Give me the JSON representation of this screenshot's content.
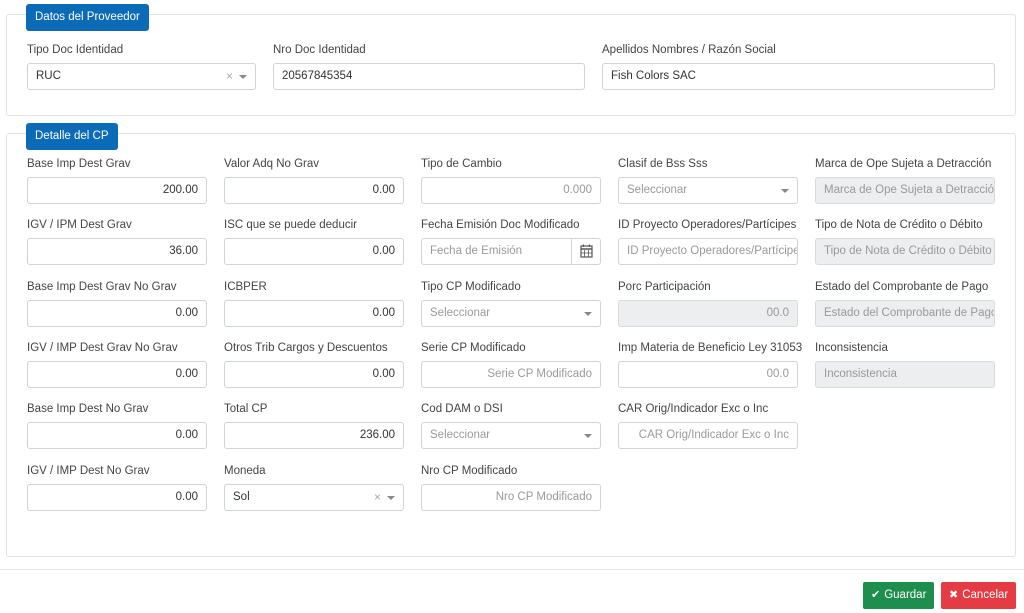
{
  "proveedor": {
    "title": "Datos del Proveedor",
    "tipo_doc": {
      "label": "Tipo Doc Identidad",
      "value": "RUC"
    },
    "nro_doc": {
      "label": "Nro Doc Identidad",
      "value": "20567845354"
    },
    "razon_social": {
      "label": "Apellidos Nombres / Razón Social",
      "value": "Fish Colors SAC"
    }
  },
  "detalle": {
    "title": "Detalle del CP",
    "col1": [
      {
        "label": "Base Imp Dest Grav",
        "value": "200.00"
      },
      {
        "label": "IGV / IPM Dest Grav",
        "value": "36.00"
      },
      {
        "label": "Base Imp Dest Grav No Grav",
        "value": "0.00"
      },
      {
        "label": "IGV / IMP Dest Grav No Grav",
        "value": "0.00"
      },
      {
        "label": "Base Imp Dest No Grav",
        "value": "0.00"
      },
      {
        "label": "IGV / IMP Dest No Grav",
        "value": "0.00"
      }
    ],
    "col2": [
      {
        "label": "Valor Adq No Grav",
        "value": "0.00"
      },
      {
        "label": "ISC que se puede deducir",
        "value": "0.00"
      },
      {
        "label": "ICBPER",
        "value": "0.00"
      },
      {
        "label": "Otros Trib Cargos y Descuentos",
        "value": "0.00"
      },
      {
        "label": "Total CP",
        "value": "236.00"
      },
      {
        "label": "Moneda",
        "value": "Sol"
      }
    ],
    "col3": [
      {
        "label": "Tipo de Cambio",
        "placeholder": "0.000"
      },
      {
        "label": "Fecha Emisión Doc Modificado",
        "placeholder": "Fecha de Emisión"
      },
      {
        "label": "Tipo CP Modificado",
        "placeholder": "Seleccionar"
      },
      {
        "label": "Serie CP Modificado",
        "placeholder": "Serie CP Modificado"
      },
      {
        "label": "Cod DAM o DSI",
        "placeholder": "Seleccionar"
      },
      {
        "label": "Nro CP Modificado",
        "placeholder": "Nro  CP Modificado"
      }
    ],
    "col4": [
      {
        "label": "Clasif de Bss Sss",
        "placeholder": "Seleccionar"
      },
      {
        "label": "ID Proyecto Operadores/Partícipes",
        "placeholder": "ID Proyecto Operadores/Partícipes"
      },
      {
        "label": "Porc Participación",
        "placeholder": "00.0"
      },
      {
        "label": "Imp Materia de Beneficio Ley 31053",
        "placeholder": "00.0"
      },
      {
        "label": "CAR Orig/Indicador Exc o Inc",
        "placeholder": "CAR Orig/Indicador Exc o Inc"
      }
    ],
    "col5": [
      {
        "label": "Marca de Ope Sujeta a Detracción",
        "placeholder": "Marca de Ope Sujeta a Detracción"
      },
      {
        "label": "Tipo de Nota de Crédito o Débito",
        "placeholder": "Tipo de Nota de Crédito o Débito"
      },
      {
        "label": "Estado del Comprobante de Pago",
        "placeholder": "Estado del Comprobante de Pago"
      },
      {
        "label": "Inconsistencia",
        "placeholder": "Inconsistencia"
      }
    ]
  },
  "actions": {
    "save_label": "Guardar",
    "cancel_label": "Cancelar"
  },
  "icons": {
    "clear": "×",
    "save": "✔",
    "cancel": "✖"
  }
}
